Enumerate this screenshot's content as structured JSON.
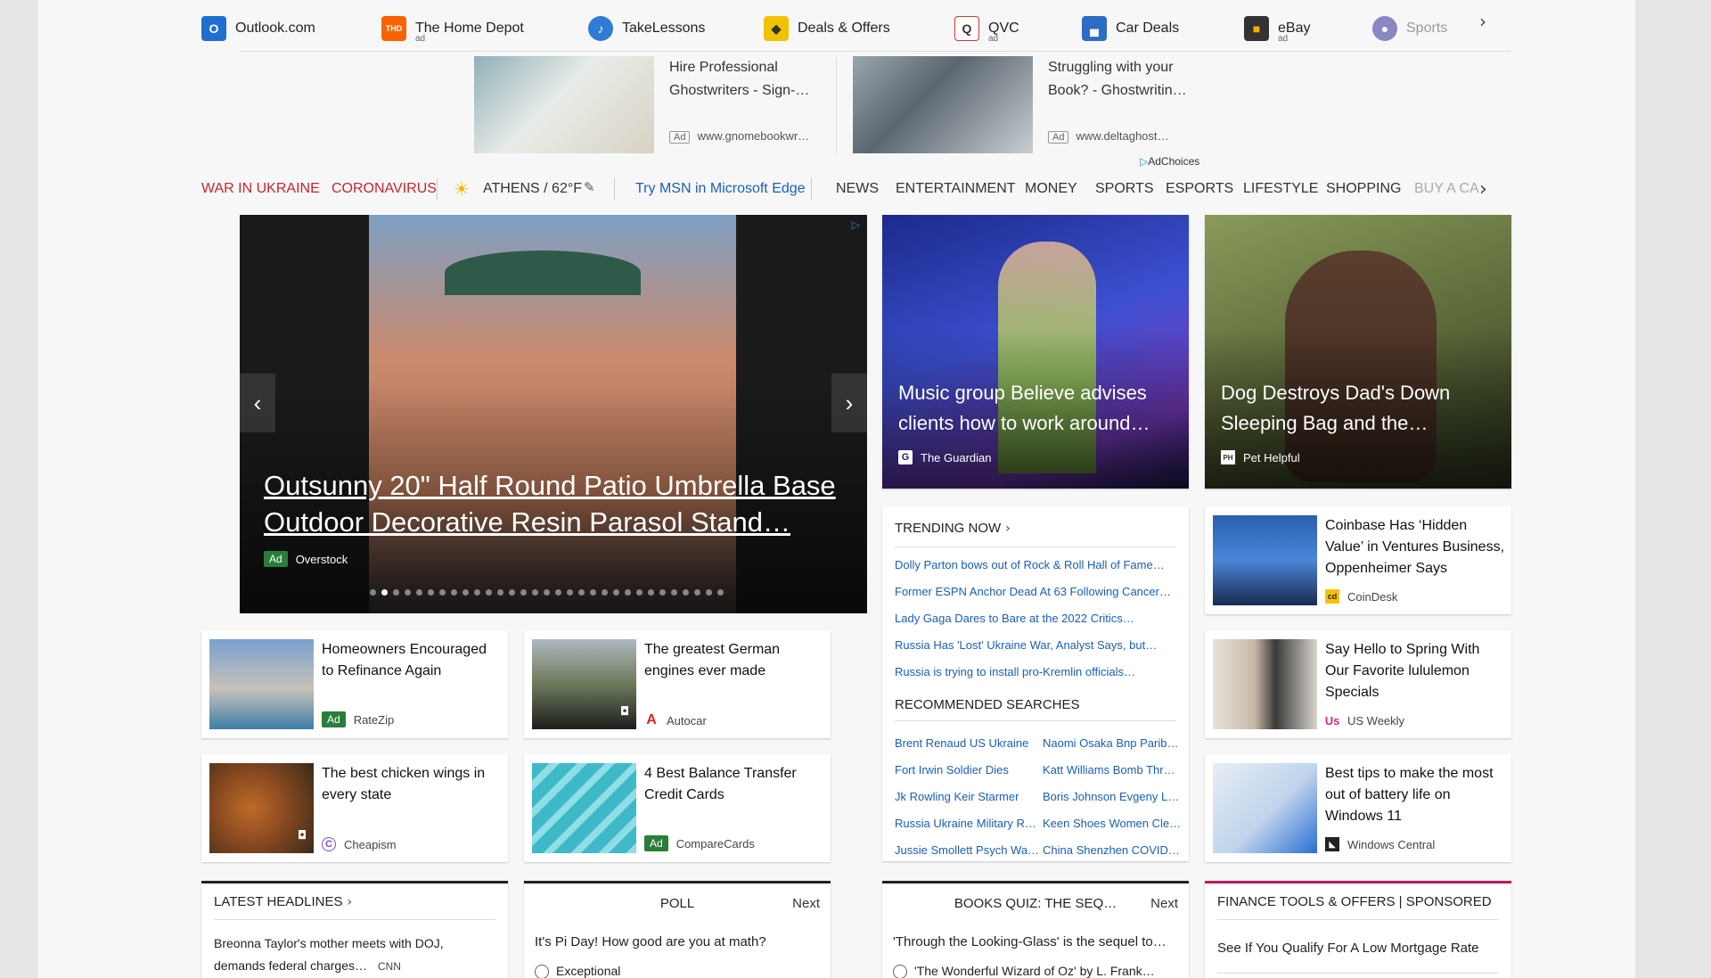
{
  "quick_links": [
    {
      "label": "Outlook.com",
      "icon": "outlook-icon",
      "ad": ""
    },
    {
      "label": "The Home Depot",
      "icon": "home-depot-icon",
      "ad": "ad"
    },
    {
      "label": "TakeLessons",
      "icon": "takelessons-icon",
      "ad": ""
    },
    {
      "label": "Deals & Offers",
      "icon": "deals-icon",
      "ad": ""
    },
    {
      "label": "QVC",
      "icon": "qvc-icon",
      "ad": "ad"
    },
    {
      "label": "Car Deals",
      "icon": "car-icon",
      "ad": ""
    },
    {
      "label": "eBay",
      "icon": "ebay-icon",
      "ad": "ad"
    },
    {
      "label": "Sports",
      "icon": "sports-icon",
      "ad": ""
    }
  ],
  "ad_strip": [
    {
      "title": "Hire Professional Ghostwriters - Sign-…",
      "badge": "Ad",
      "url": "www.gnomebookwr…"
    },
    {
      "title": "Struggling with your Book? - Ghostwritin…",
      "badge": "Ad",
      "url": "www.deltaghost…"
    }
  ],
  "adchoices": "AdChoices",
  "nav": {
    "hot": [
      "WAR IN UKRAINE",
      "CORONAVIRUS"
    ],
    "weather": "ATHENS / 62°F",
    "edge_promo": "Try MSN in Microsoft Edge",
    "items": [
      "NEWS",
      "ENTERTAINMENT",
      "MONEY",
      "SPORTS",
      "ESPORTS",
      "LIFESTYLE",
      "SHOPPING",
      "BUY A CA"
    ]
  },
  "hero": {
    "title": "Outsunny 20\" Half Round Patio Umbrella Base Outdoor Decorative Resin Parasol Stand…",
    "badge": "Ad",
    "source": "Overstock",
    "slide_count": 31,
    "active_slide": 2
  },
  "tiles": [
    {
      "title": "Music group Believe advises clients how to work around…",
      "source": "The Guardian"
    },
    {
      "title": "Dog Destroys Dad's Down Sleeping Bag and the…",
      "source": "Pet Helpful"
    }
  ],
  "cards_left": [
    {
      "title": "Homeowners Encouraged to Refinance Again",
      "badge": "Ad",
      "source": "RateZip"
    },
    {
      "title": "The greatest German engines ever made",
      "badge": "",
      "source": "Autocar"
    },
    {
      "title": "The best chicken wings in every state",
      "badge": "",
      "source": "Cheapism"
    },
    {
      "title": "4 Best Balance Transfer Credit Cards",
      "badge": "Ad",
      "source": "CompareCards"
    }
  ],
  "cards_right": [
    {
      "title": "Coinbase Has ‘Hidden Value’ in Ventures Business, Oppenheimer Says",
      "source": "CoinDesk"
    },
    {
      "title": "Say Hello to Spring With Our Favorite lululemon Specials",
      "source": "US Weekly"
    },
    {
      "title": "Best tips to make the most out of battery life on Windows 11",
      "source": "Windows Central"
    }
  ],
  "trending": {
    "heading": "TRENDING NOW",
    "items": [
      "Dolly Parton bows out of Rock & Roll Hall of Fame…",
      "Former ESPN Anchor Dead At 63 Following Cancer…",
      "Lady Gaga Dares to Bare at the 2022 Critics…",
      "Russia Has 'Lost' Ukraine War, Analyst Says, but…",
      "Russia is trying to install pro-Kremlin officials…"
    ]
  },
  "recommended": {
    "heading": "RECOMMENDED SEARCHES",
    "col1": [
      "Brent Renaud US Ukraine",
      "Fort Irwin Soldier Dies",
      "Jk Rowling Keir Starmer",
      "Russia Ukraine Military R…",
      "Jussie Smollett Psych Wa…"
    ],
    "col2": [
      "Naomi Osaka Bnp Parib…",
      "Katt Williams Bomb Thr…",
      "Boris Johnson Evgeny L…",
      "Keen Shoes Women Cle…",
      "China Shenzhen COVID…"
    ]
  },
  "bottom": {
    "latest": {
      "heading": "LATEST HEADLINES",
      "text": "Breonna Taylor's mother meets with DOJ, demands federal charges…",
      "source": "CNN"
    },
    "poll": {
      "heading": "POLL",
      "next": "Next",
      "question": "It's Pi Day! How good are you at math?",
      "option": "Exceptional"
    },
    "quiz": {
      "heading": "BOOKS QUIZ: THE SEQ…",
      "next": "Next",
      "question": "'Through the Looking-Glass' is the sequel to…",
      "option": "'The Wonderful Wizard of Oz' by L. Frank…"
    },
    "finance": {
      "heading": "FINANCE TOOLS & OFFERS | SPONSORED",
      "text": "See If You Qualify For A Low Mortgage Rate"
    }
  },
  "colors": {
    "hot_red": "#c4262e",
    "link_blue": "#1a5fb4",
    "ad_green": "#2a7d3a"
  }
}
